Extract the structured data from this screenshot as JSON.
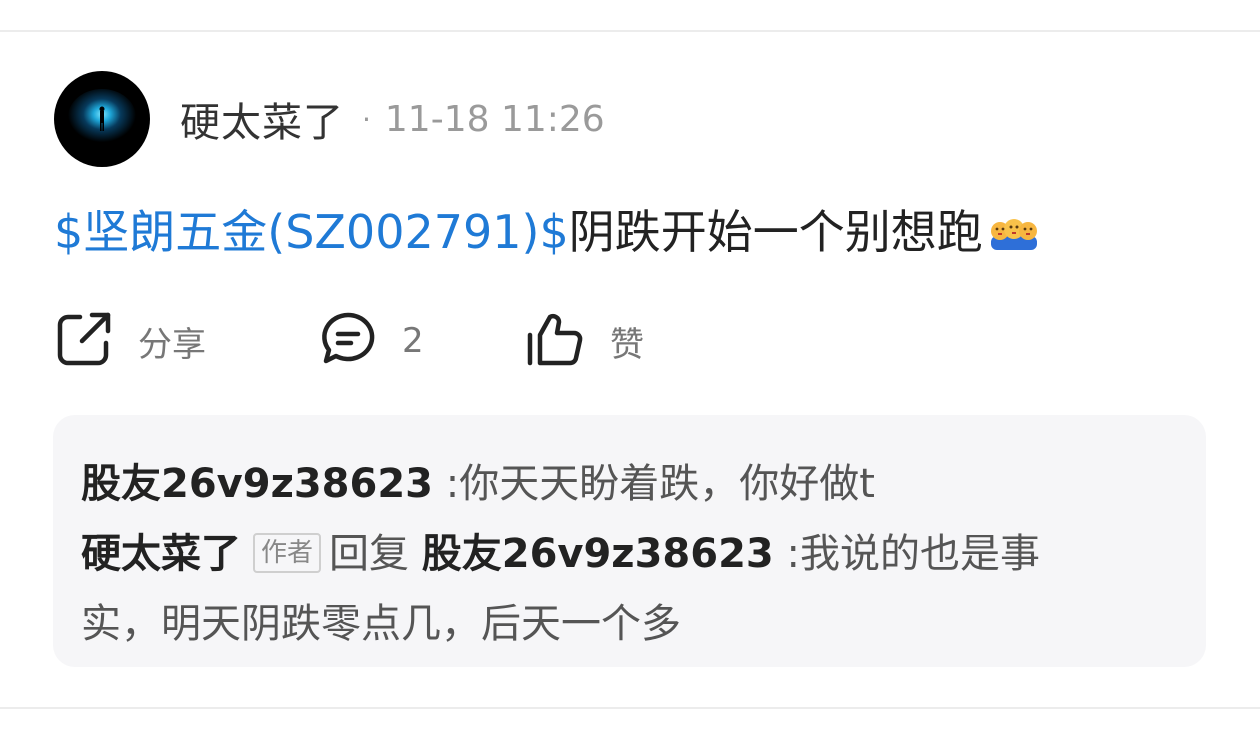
{
  "post": {
    "author": "硬太菜了",
    "separator": "·",
    "time": "11-18 11:26",
    "stock_link": "$坚朗五金(SZ002791)$",
    "content": "阴跌开始一个别想跑",
    "emoji": "hug-emoji"
  },
  "actions": {
    "share_label": "分享",
    "comment_count": "2",
    "like_label": "赞"
  },
  "comments": [
    {
      "name": "股友26v9z38623",
      "colon": " :",
      "text": "你天天盼着跌，你好做t"
    },
    {
      "name": "硬太菜了",
      "author_tag": "作者",
      "reply_word": "回复",
      "reply_to": "股友26v9z38623",
      "colon": ":",
      "text_line1": "我说的也是事",
      "text_line2": "实，明天阴跌零点几，后天一个多"
    }
  ],
  "colors": {
    "link": "#1f7ad6",
    "muted": "#9a9a9a",
    "comment_bg": "#f6f6f8"
  }
}
